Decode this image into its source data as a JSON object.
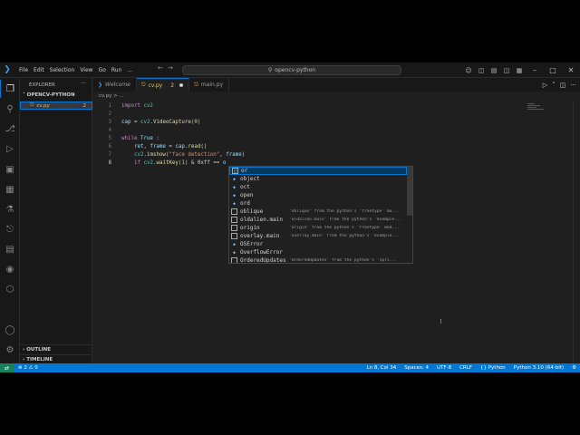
{
  "titlebar": {
    "menu": [
      "File",
      "Edit",
      "Selection",
      "View",
      "Go",
      "Run"
    ],
    "menu_more": "...",
    "search_text": "opencv-python"
  },
  "sidebar": {
    "title": "EXPLORER",
    "project": "OPENCV-PYTHON",
    "file_name": "cv.py",
    "file_problems": "2",
    "outline": "OUTLINE",
    "timeline": "TIMELINE"
  },
  "tabs": [
    {
      "label": "Welcome"
    },
    {
      "label": "cv.py",
      "badge": "2"
    },
    {
      "label": "main.py"
    }
  ],
  "breadcrumb": "cv.py > ...",
  "editor": {
    "line_numbers": [
      "1",
      "2",
      "3",
      "4",
      "5",
      "6",
      "7",
      "8"
    ],
    "lines": {
      "l1": {
        "kw": "import",
        "mod": "cv2"
      },
      "l3": {
        "var": "cap",
        "eq": "=",
        "mod": "cv2",
        "fn": "VideoCapture",
        "arg": "(0)"
      },
      "l5": {
        "kw": "while",
        "val": "True",
        "colon": ":"
      },
      "l6": {
        "vars": "ret, frame",
        "eq": "=",
        "obj": "cap",
        "fn": "read",
        "paren": "()"
      },
      "l7": {
        "mod": "cv2",
        "fn": "imshow",
        "str": "\"face detection\"",
        "arg": "frame"
      },
      "l8": {
        "kw": "if",
        "mod": "cv2",
        "fn": "waitKey",
        "arg": "(1)",
        "op": "& 0xff ==",
        "typed": "o"
      }
    }
  },
  "suggest": {
    "items": [
      {
        "label": "or",
        "kind": "keyword",
        "detail": ""
      },
      {
        "label": "object",
        "kind": "class",
        "detail": ""
      },
      {
        "label": "oct",
        "kind": "function",
        "detail": ""
      },
      {
        "label": "open",
        "kind": "function",
        "detail": ""
      },
      {
        "label": "ord",
        "kind": "function",
        "detail": ""
      },
      {
        "label": "oblique",
        "kind": "module",
        "detail": "'oblique' from the python's 'freetype' mo..."
      },
      {
        "label": "oldalien.main",
        "kind": "module",
        "detail": "'oldalien.main' from the python's 'example..."
      },
      {
        "label": "origin",
        "kind": "module",
        "detail": "'origin' from the python's 'freetype' mod..."
      },
      {
        "label": "overlay.main",
        "kind": "module",
        "detail": "'overlay.main' from the python's 'example..."
      },
      {
        "label": "OSError",
        "kind": "class",
        "detail": ""
      },
      {
        "label": "OverflowError",
        "kind": "class",
        "detail": ""
      },
      {
        "label": "OrderedUpdates",
        "kind": "module",
        "detail": "'OrderedUpdates' from the python's 'spri..."
      }
    ]
  },
  "status": {
    "problems": "2",
    "warnings": "0",
    "position": "Ln 8, Col 34",
    "spaces": "Spaces: 4",
    "encoding": "UTF-8",
    "eol": "CRLF",
    "language": "Python",
    "interpreter": "Python 3.10 (64-bit)"
  },
  "colors": {
    "accent": "#0078d4",
    "remote": "#16825d",
    "keyword": "#c586c0"
  }
}
